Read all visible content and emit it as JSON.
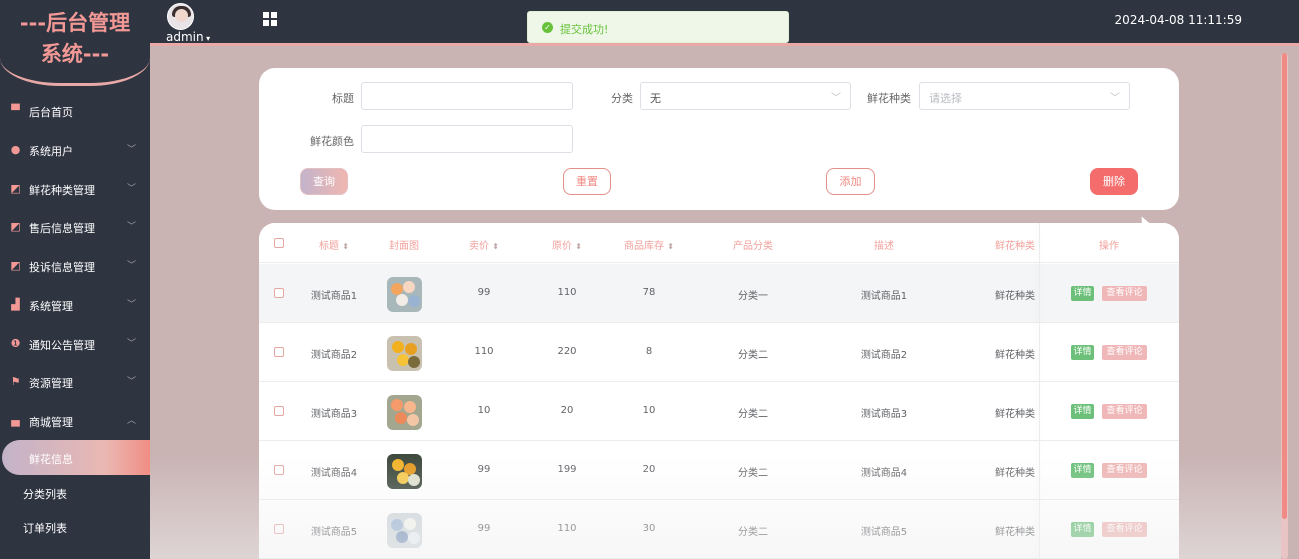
{
  "app": {
    "logo_line1": "---后台管理",
    "logo_line2": "系统---",
    "user": "admin",
    "datetime": "2024-04-08 11:11:59"
  },
  "toast": {
    "message": "提交成功!",
    "icon": "check-circle-icon",
    "color": "#67c23a"
  },
  "sidebar": {
    "items": [
      {
        "label": "后台首页",
        "icon": "monitor-icon",
        "glyph": "▀",
        "arrow": ""
      },
      {
        "label": "系统用户",
        "icon": "user-icon",
        "glyph": "●",
        "arrow": "﹀"
      },
      {
        "label": "鲜花种类管理",
        "icon": "chart-icon",
        "glyph": "◩",
        "arrow": "﹀"
      },
      {
        "label": "售后信息管理",
        "icon": "chart-icon",
        "glyph": "◩",
        "arrow": "﹀"
      },
      {
        "label": "投诉信息管理",
        "icon": "chart-icon",
        "glyph": "◩",
        "arrow": "﹀"
      },
      {
        "label": "系统管理",
        "icon": "bar-chart-icon",
        "glyph": "▟",
        "arrow": "﹀"
      },
      {
        "label": "通知公告管理",
        "icon": "info-icon",
        "glyph": "❶",
        "arrow": "﹀"
      },
      {
        "label": "资源管理",
        "icon": "flag-icon",
        "glyph": "⚑",
        "arrow": "﹀"
      },
      {
        "label": "商城管理",
        "icon": "shop-icon",
        "glyph": "▄",
        "arrow": "︿"
      }
    ],
    "sub_items": [
      {
        "label": "鲜花信息",
        "active": true
      },
      {
        "label": "分类列表",
        "active": false
      },
      {
        "label": "订单列表",
        "active": false
      }
    ]
  },
  "search": {
    "title_label": "标题",
    "title_value": "",
    "category_label": "分类",
    "category_value": "无",
    "species_label": "鲜花种类",
    "species_placeholder": "请选择",
    "color_label": "鲜花颜色",
    "color_value": "",
    "btn_search": "查询",
    "btn_reset": "重置",
    "btn_add": "添加",
    "btn_delete": "删除"
  },
  "table": {
    "headers": {
      "title": "标题",
      "cover": "封面图",
      "price": "卖价",
      "orig_price": "原价",
      "stock": "商品库存",
      "category": "产品分类",
      "desc": "描述",
      "species": "鲜花种类",
      "actions": "操作"
    },
    "detail_label": "详情",
    "review_label": "查看评论",
    "rows": [
      {
        "title": "测试商品1",
        "price": "99",
        "orig_price": "110",
        "stock": "78",
        "category": "分类一",
        "desc": "测试商品1",
        "species": "鲜花种类"
      },
      {
        "title": "测试商品2",
        "price": "110",
        "orig_price": "220",
        "stock": "8",
        "category": "分类二",
        "desc": "测试商品2",
        "species": "鲜花种类"
      },
      {
        "title": "测试商品3",
        "price": "10",
        "orig_price": "20",
        "stock": "10",
        "category": "分类二",
        "desc": "测试商品3",
        "species": "鲜花种类"
      },
      {
        "title": "测试商品4",
        "price": "99",
        "orig_price": "199",
        "stock": "20",
        "category": "分类二",
        "desc": "测试商品4",
        "species": "鲜花种类"
      },
      {
        "title": "测试商品5",
        "price": "99",
        "orig_price": "110",
        "stock": "30",
        "category": "分类二",
        "desc": "测试商品5",
        "species": "鲜花种类"
      }
    ]
  },
  "colors": {
    "accent": "#f29895",
    "sidebar_bg": "#2f3441",
    "page_bg": "#c9b3b3",
    "delete": "#f46c6c",
    "detail": "#6cc07a",
    "review": "#efb7b7"
  }
}
